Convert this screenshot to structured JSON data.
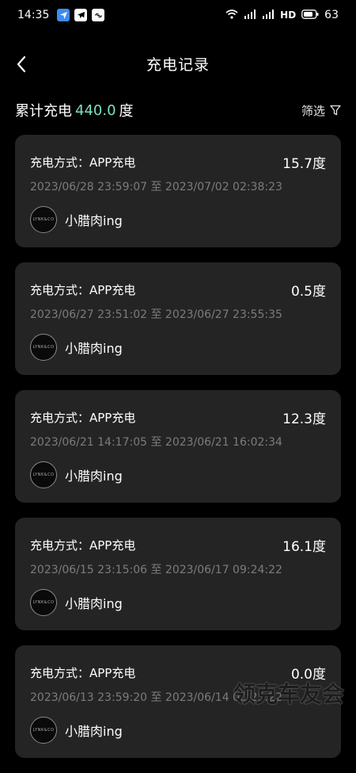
{
  "status_bar": {
    "time": "14:35",
    "left_icons": [
      "navigation-icon",
      "telegram-icon",
      "link-icon"
    ],
    "right_text_signal1": "HD",
    "battery": "63"
  },
  "header": {
    "title": "充电记录",
    "back_icon": "chevron-left-icon"
  },
  "summary": {
    "label": "累计充电",
    "value": "440.0",
    "unit": "度",
    "value_color": "#7fe0c4",
    "filter_label": "筛选",
    "filter_icon": "funnel-icon"
  },
  "records": [
    {
      "method": "充电方式：APP充电",
      "amount": "15.7度",
      "time": "2023/06/28 23:59:07 至 2023/07/02 02:38:23",
      "user": "小腊肉ing",
      "avatar_text": "LYNK&CO"
    },
    {
      "method": "充电方式：APP充电",
      "amount": "0.5度",
      "time": "2023/06/27 23:51:02 至 2023/06/27 23:55:35",
      "user": "小腊肉ing",
      "avatar_text": "LYNK&CO"
    },
    {
      "method": "充电方式：APP充电",
      "amount": "12.3度",
      "time": "2023/06/21 14:17:05 至 2023/06/21 16:02:34",
      "user": "小腊肉ing",
      "avatar_text": "LYNK&CO"
    },
    {
      "method": "充电方式：APP充电",
      "amount": "16.1度",
      "time": "2023/06/15 23:15:06 至 2023/06/17 09:24:22",
      "user": "小腊肉ing",
      "avatar_text": "LYNK&CO"
    },
    {
      "method": "充电方式：APP充电",
      "amount": "0.0度",
      "time": "2023/06/13 23:59:20 至 2023/06/14 00:25:22",
      "user": "小腊肉ing",
      "avatar_text": "LYNK&CO"
    }
  ],
  "watermark": "领克车友会"
}
